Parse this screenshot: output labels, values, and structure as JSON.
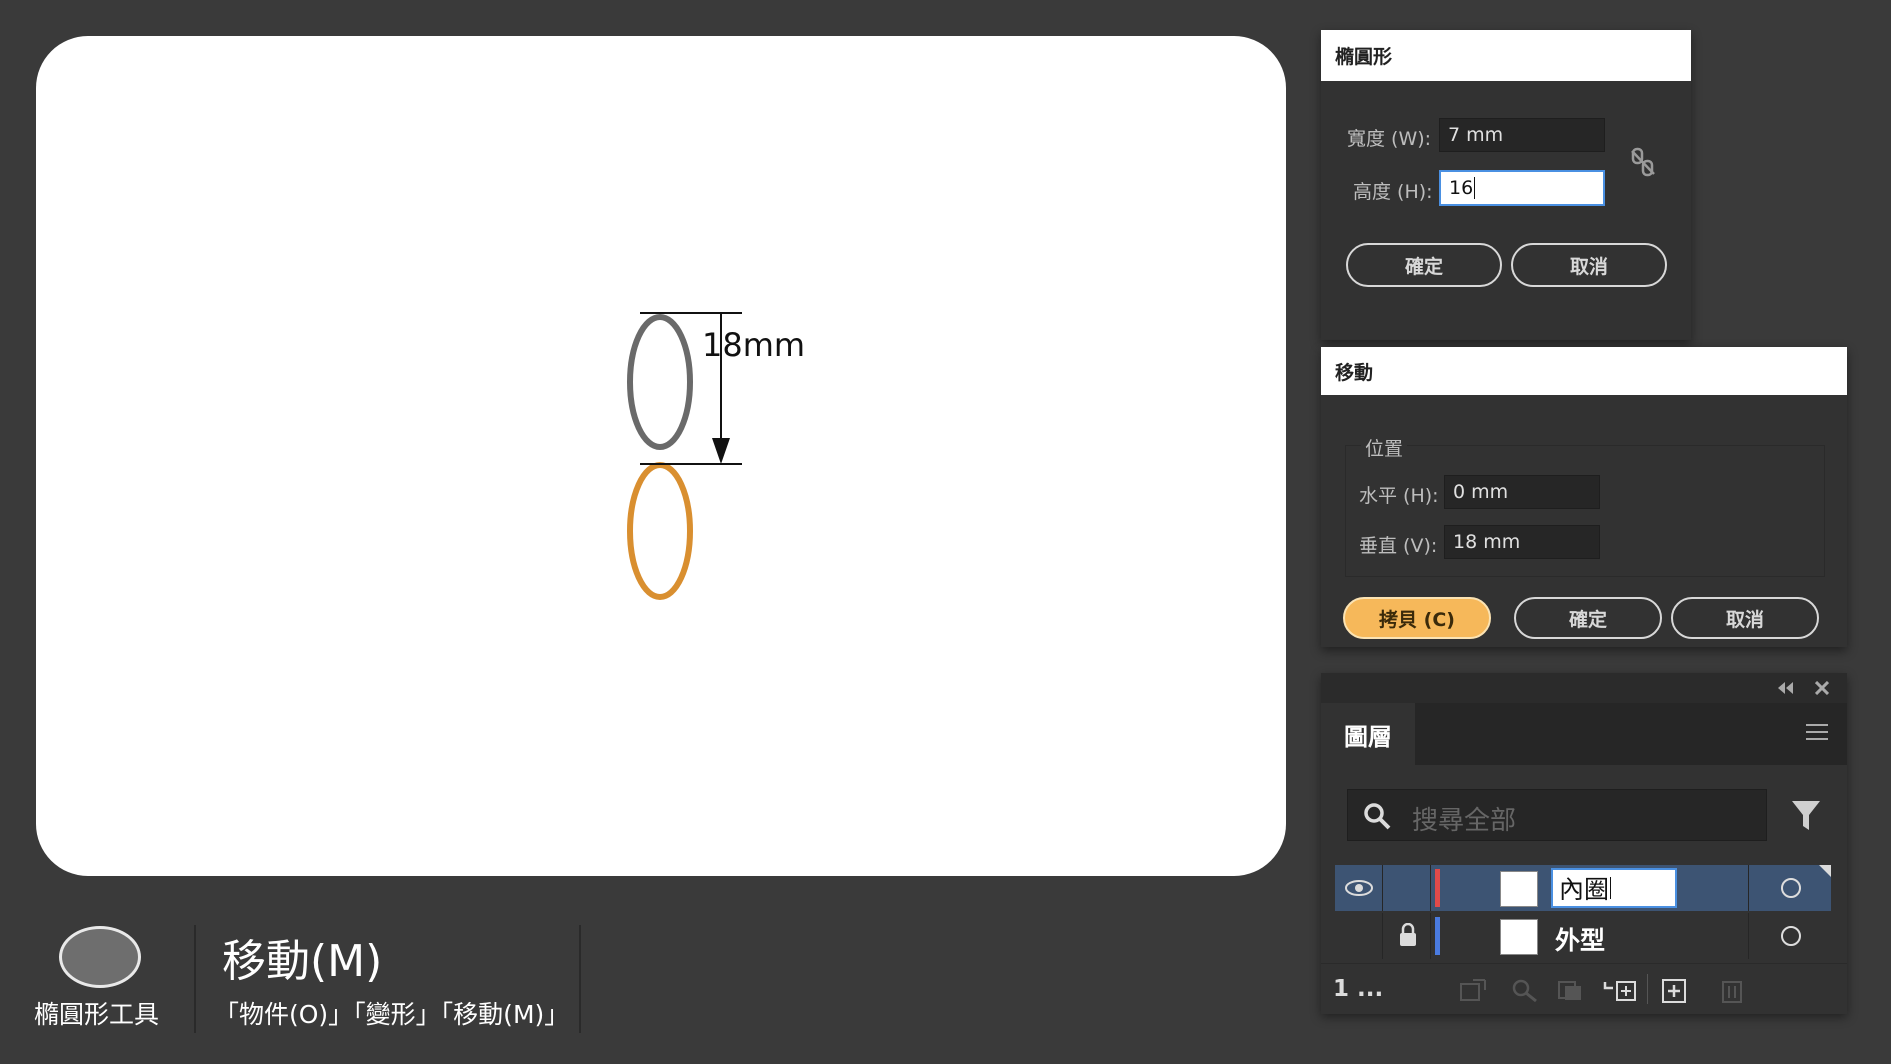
{
  "artboard": {
    "dimension_label": "18mm",
    "colors": {
      "top_ellipse": "#6a6a6a",
      "bottom_ellipse": "#d98f30"
    }
  },
  "caption": {
    "tool_name": "橢圓形工具",
    "command_title": "移動(M)",
    "command_path": "「物件(O)」「變形」「移動(M)」"
  },
  "ellipse_dialog": {
    "title": "橢圓形",
    "width_label": "寬度 (W):",
    "width_value": "7 mm",
    "height_label": "高度 (H):",
    "height_value": "16",
    "ok_label": "確定",
    "cancel_label": "取消"
  },
  "move_dialog": {
    "title": "移動",
    "position_group": "位置",
    "horizontal_label": "水平 (H):",
    "horizontal_value": "0 mm",
    "vertical_label": "垂直 (V):",
    "vertical_value": "18 mm",
    "copy_label": "拷貝 (C)",
    "ok_label": "確定",
    "cancel_label": "取消"
  },
  "layers_panel": {
    "tab_label": "圖層",
    "search_placeholder": "搜尋全部",
    "layers": [
      {
        "name": "內圈",
        "editing": true,
        "visible": true,
        "locked": false,
        "color": "#e04a4a"
      },
      {
        "name": "外型",
        "editing": false,
        "visible": false,
        "locked": true,
        "color": "#4a7be0"
      }
    ],
    "layer_count": "1 ..."
  }
}
